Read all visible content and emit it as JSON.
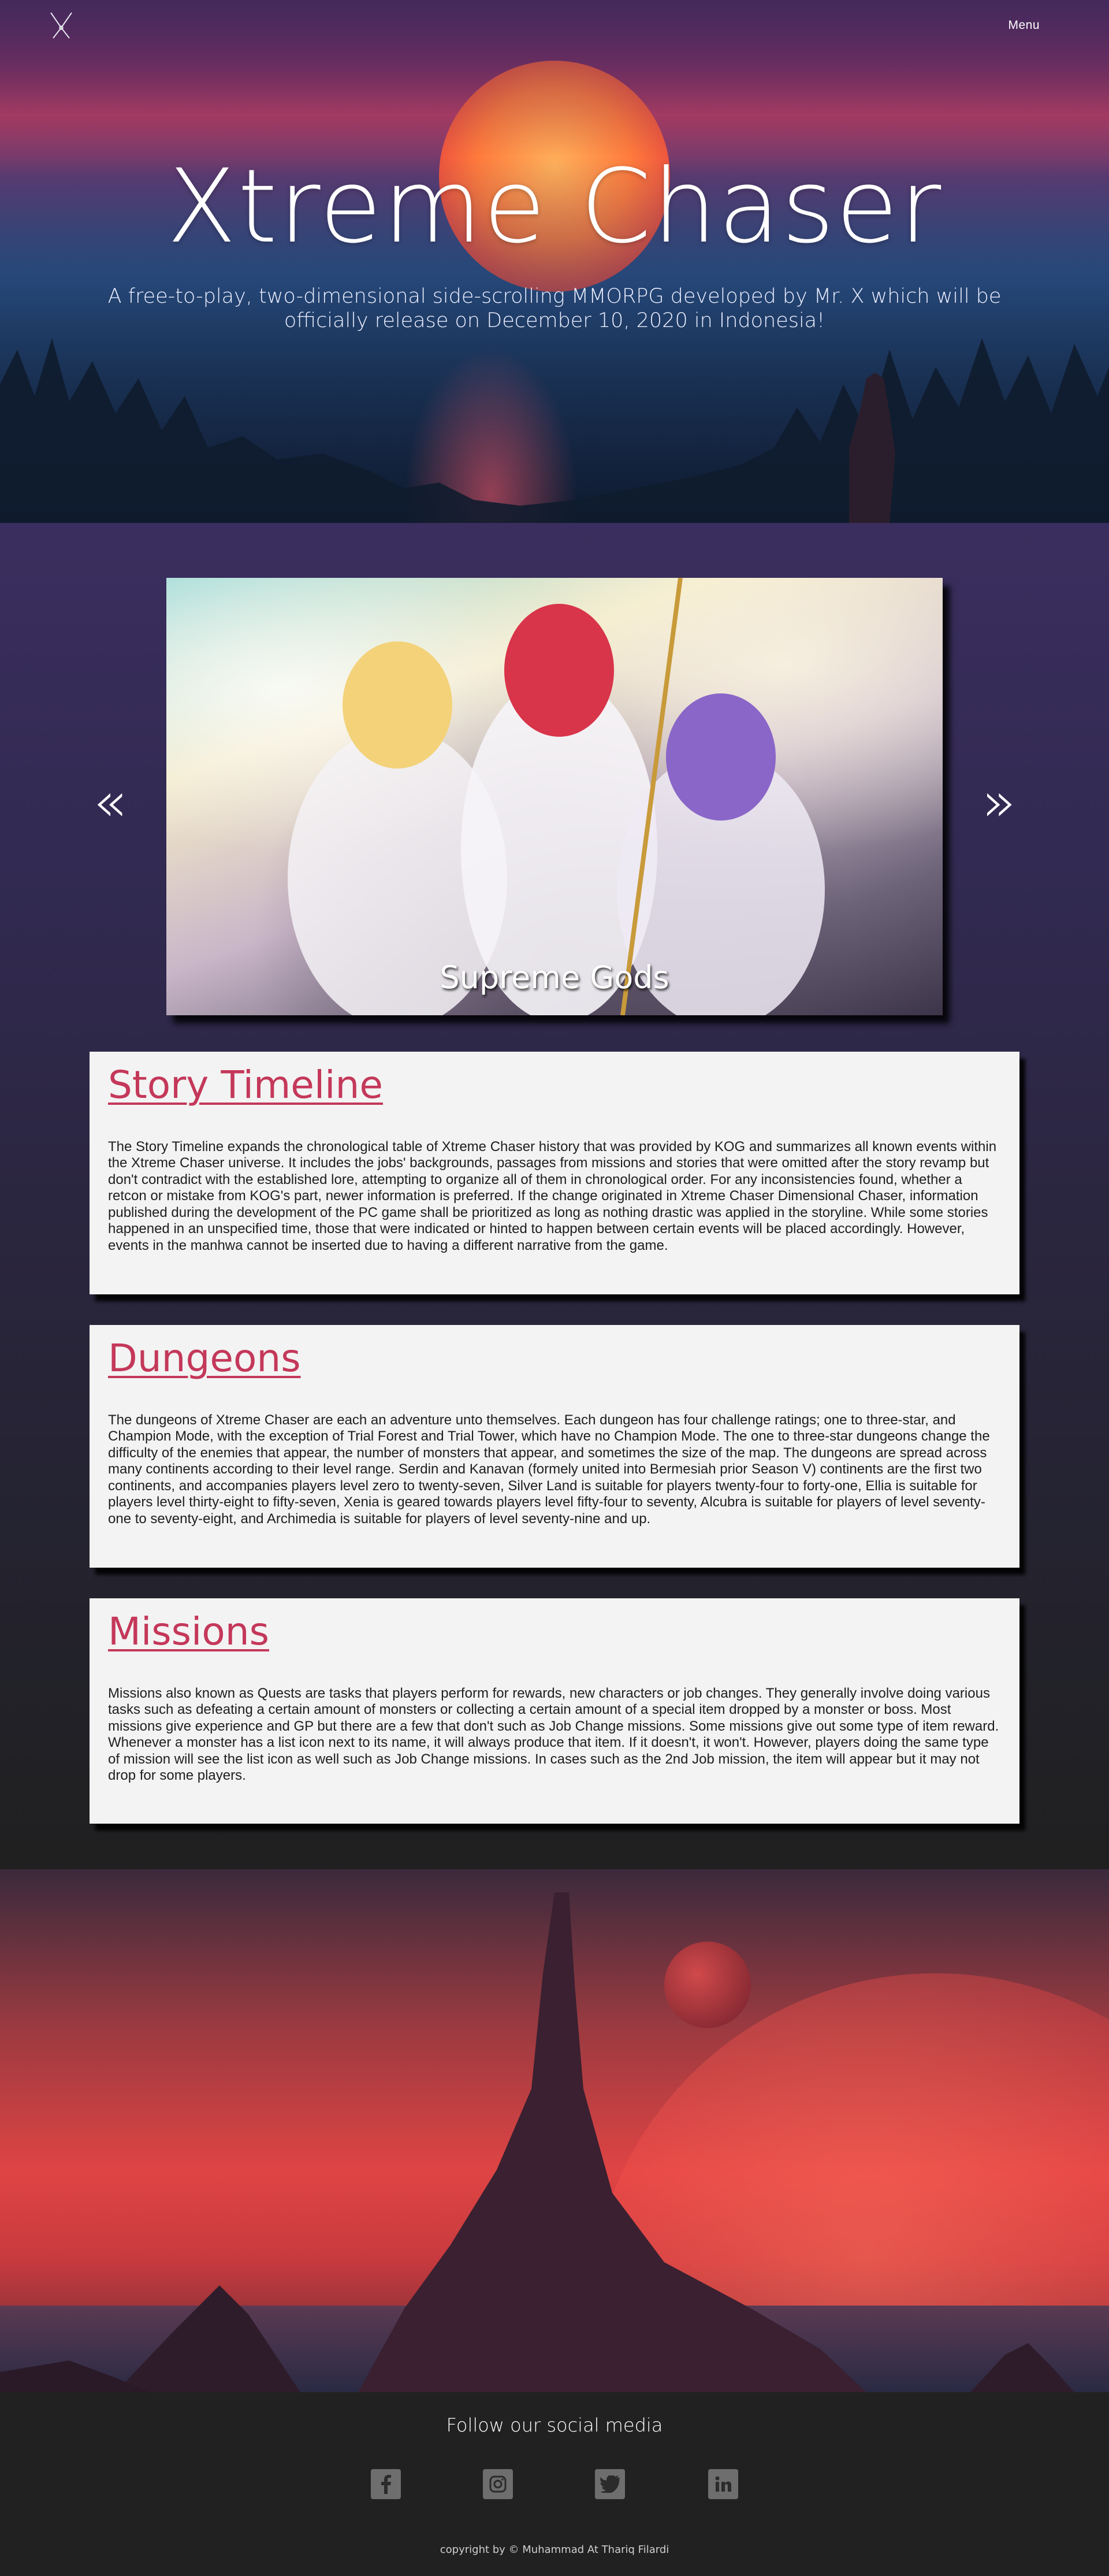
{
  "nav": {
    "logo_icon": "crossed-blades-logo-icon",
    "menu_label": "Menu"
  },
  "hero": {
    "title": "Xtreme Chaser",
    "subtitle": "A free-to-play, two-dimensional side-scrolling MMORPG developed by Mr. X which will be officially release on December 10, 2020 in Indonesia!"
  },
  "carousel": {
    "caption": "Supreme Gods",
    "prev_icon": "double-chevron-left-icon",
    "next_icon": "double-chevron-right-icon",
    "prev_glyph": "«",
    "next_glyph": "»"
  },
  "sections": [
    {
      "title": "Story Timeline",
      "body": "The Story Timeline expands the chronological table of Xtreme Chaser history that was provided by KOG and summarizes all known events within the Xtreme Chaser universe. It includes the jobs' backgrounds, passages from missions and stories that were omitted after the story revamp but don't contradict with the established lore, attempting to organize all of them in chronological order. For any inconsistencies found, whether a retcon or mistake from KOG's part, newer information is preferred. If the change originated in Xtreme Chaser Dimensional Chaser, information published during the development of the PC game shall be prioritized as long as nothing drastic was applied in the storyline. While some stories happened in an unspecified time, those that were indicated or hinted to happen between certain events will be placed accordingly. However, events in the manhwa cannot be inserted due to having a different narrative from the game."
    },
    {
      "title": "Dungeons",
      "body": "The dungeons of Xtreme Chaser are each an adventure unto themselves. Each dungeon has four challenge ratings; one to three-star, and Champion Mode, with the exception of Trial Forest and Trial Tower, which have no Champion Mode. The one to three-star dungeons change the difficulty of the enemies that appear, the number of monsters that appear, and sometimes the size of the map. The dungeons are spread across many continents according to their level range. Serdin and Kanavan (formely united into Bermesiah prior Season V) continents are the first two continents, and accompanies players level zero to twenty-seven, Silver Land is suitable for players twenty-four to forty-one, Ellia is suitable for players level thirty-eight to fifty-seven, Xenia is geared towards players level fifty-four to seventy, Alcubra is suitable for players of level seventy-one to seventy-eight, and Archimedia is suitable for players of level seventy-nine and up."
    },
    {
      "title": "Missions",
      "body": "Missions also known as Quests are tasks that players perform for rewards, new characters or job changes. They generally involve doing various tasks such as defeating a certain amount of monsters or collecting a certain amount of a special item dropped by a monster or boss. Most missions give experience and GP but there are a few that don't such as Job Change missions. Some missions give out some type of item reward. Whenever a monster has a list icon next to its name, it will always produce that item. If it doesn't, it won't. However, players doing the same type of mission will see the list icon as well such as Job Change missions. In cases such as the 2nd Job mission, the item will appear but it may not drop for some players."
    }
  ],
  "footer": {
    "follow_label": "Follow our social media",
    "social": [
      {
        "name": "facebook",
        "icon": "facebook-icon"
      },
      {
        "name": "instagram",
        "icon": "instagram-icon"
      },
      {
        "name": "twitter",
        "icon": "twitter-icon"
      },
      {
        "name": "linkedin",
        "icon": "linkedin-icon"
      }
    ],
    "copyright": "copyright by © Muhammad At Thariq Filardi"
  },
  "colors": {
    "accent": "#c4385a",
    "card_bg": "#f3f3f3",
    "footer_bg": "#212121",
    "icon_gray": "#6e6e6e"
  }
}
